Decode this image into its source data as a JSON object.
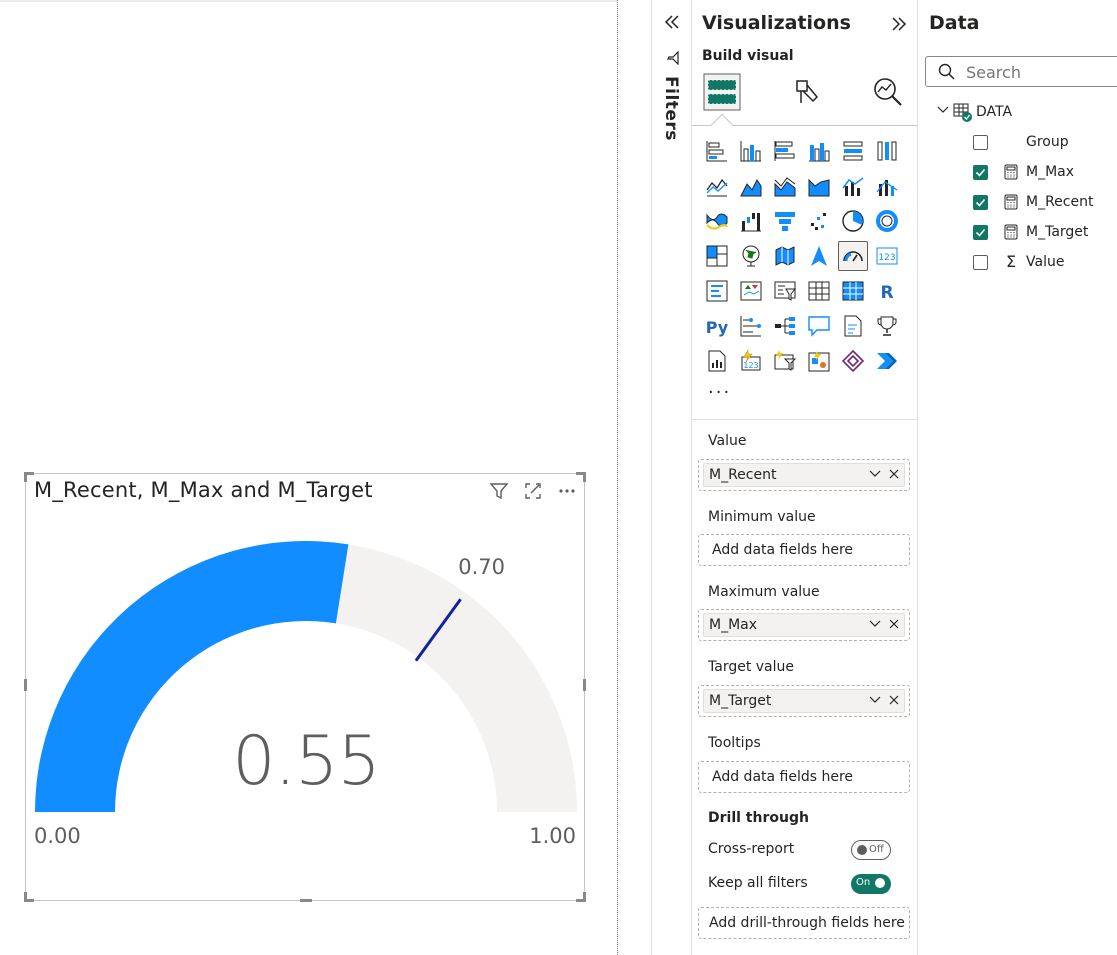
{
  "gauge": {
    "title": "M_Recent, M_Max and M_Target",
    "value": 0.55,
    "value_text": "0.55",
    "min": 0,
    "min_text": "0.00",
    "max": 1,
    "max_text": "1.00",
    "target": 0.7,
    "target_text": "0.70",
    "fill_color": "#118dff",
    "track_color": "#f3f2f1",
    "target_color": "#12239e"
  },
  "filters": {
    "label": "Filters"
  },
  "visualizations": {
    "title": "Visualizations",
    "build_visual_label": "Build visual",
    "more_label": "···",
    "wells": [
      {
        "label": "Value",
        "field": "M_Recent"
      },
      {
        "label": "Minimum value",
        "placeholder": "Add data fields here"
      },
      {
        "label": "Maximum value",
        "field": "M_Max"
      },
      {
        "label": "Target value",
        "field": "M_Target"
      },
      {
        "label": "Tooltips",
        "placeholder": "Add data fields here"
      }
    ],
    "drill_through": {
      "heading": "Drill through",
      "cross_report_label": "Cross-report",
      "cross_report_state": "Off",
      "keep_filters_label": "Keep all filters",
      "keep_filters_state": "On",
      "drop_placeholder": "Add drill-through fields here"
    }
  },
  "data": {
    "title": "Data",
    "search_placeholder": "Search",
    "table_name": "DATA",
    "fields": [
      {
        "name": "Group",
        "checked": false,
        "type": "none"
      },
      {
        "name": "M_Max",
        "checked": true,
        "type": "calculator"
      },
      {
        "name": "M_Recent",
        "checked": true,
        "type": "calculator"
      },
      {
        "name": "M_Target",
        "checked": true,
        "type": "calculator"
      },
      {
        "name": "Value",
        "checked": false,
        "type": "sigma"
      }
    ]
  },
  "colors": {
    "accent_green": "#117865",
    "powerbi_blue": "#118dff"
  }
}
